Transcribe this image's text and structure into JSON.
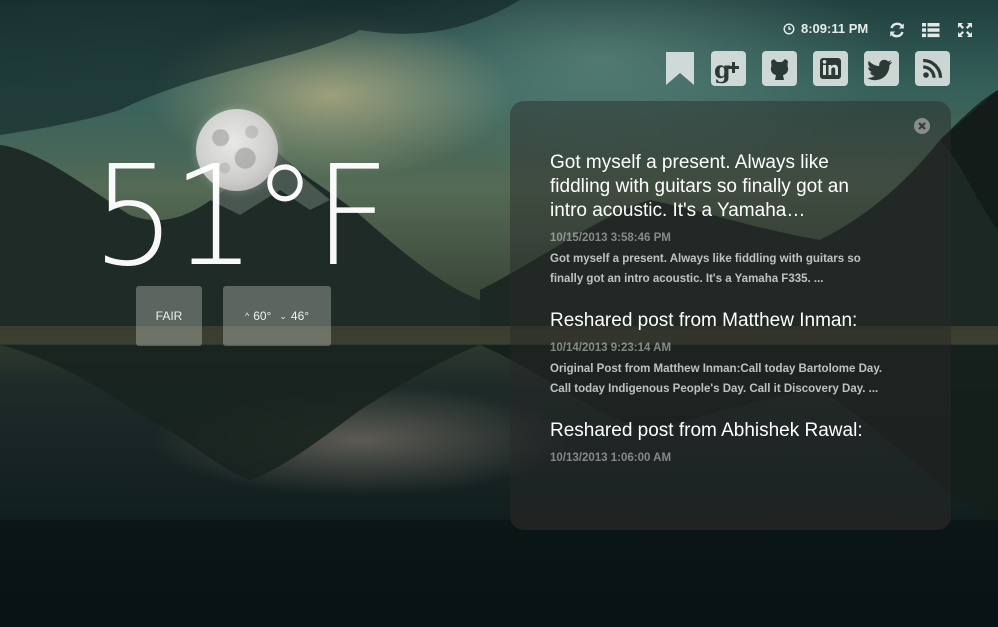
{
  "clock": {
    "icon": "clock-icon",
    "time": "8:09:11 PM"
  },
  "toolbar": {
    "refresh_icon": "refresh-icon",
    "list_icon": "list-icon",
    "fullscreen_icon": "fullscreen-icon"
  },
  "social": [
    {
      "name": "bookmark-icon"
    },
    {
      "name": "google-plus-icon"
    },
    {
      "name": "github-icon"
    },
    {
      "name": "linkedin-icon"
    },
    {
      "name": "twitter-icon"
    },
    {
      "name": "rss-icon"
    }
  ],
  "weather": {
    "temperature": "51°F",
    "condition": "FAIR",
    "high": "60°",
    "low": "46°",
    "icon": "moon-icon"
  },
  "feed": {
    "close_icon": "close-icon",
    "posts": [
      {
        "title": "Got myself a present. Always like fiddling with guitars so finally got an intro acoustic. It's a Yamaha…",
        "date": "10/15/2013 3:58:46 PM",
        "snippet": "Got myself a present. Always like fiddling with guitars so finally got an intro acoustic. It's a Yamaha F335. ..."
      },
      {
        "title": "Reshared post from Matthew Inman:",
        "date": "10/14/2013 9:23:14 AM",
        "snippet": "Original Post from Matthew Inman:Call today Bartolome Day. Call today Indigenous People's Day.  Call it Discovery Day. ..."
      },
      {
        "title": "Reshared post from Abhishek Rawal:",
        "date": "10/13/2013 1:06:00 AM",
        "snippet": ""
      }
    ]
  },
  "colors": {
    "panel": "#282828",
    "text": "#ffffff",
    "muted": "#a0a0a0"
  }
}
